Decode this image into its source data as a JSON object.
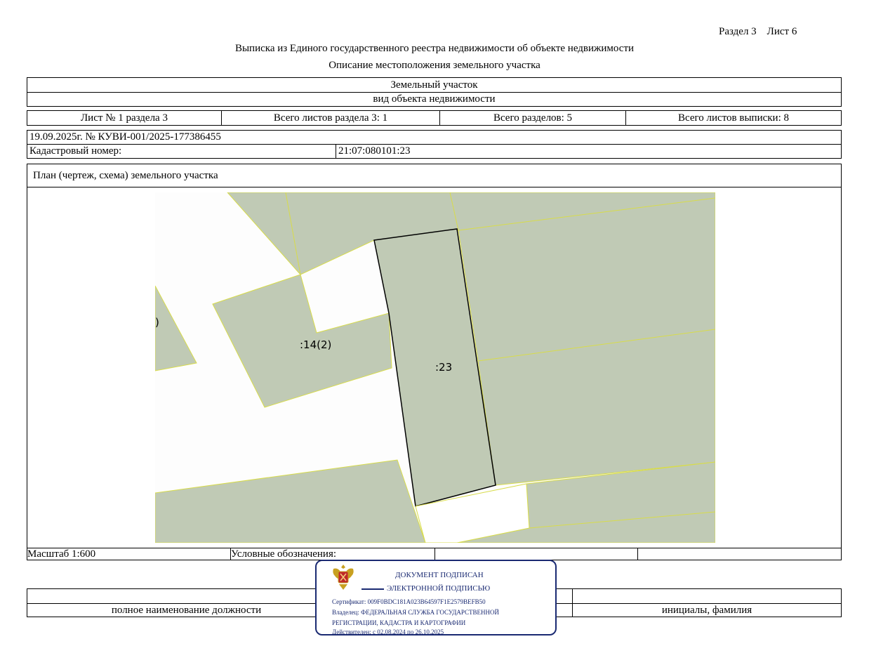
{
  "header": {
    "section_sheet": "Раздел 3    Лист 6",
    "title": "Выписка из Единого государственного реестра недвижимости об объекте недвижимости",
    "subtitle": "Описание местоположения земельного участка"
  },
  "object": {
    "type": "Земельный участок",
    "type_caption": "вид объекта недвижимости"
  },
  "sheets": {
    "sheet_no": "Лист № 1 раздела 3",
    "total_section_sheets": "Всего листов раздела 3: 1",
    "total_sections": "Всего разделов: 5",
    "total_extract_sheets": "Всего листов выписки: 8"
  },
  "record": {
    "date_number": "19.09.2025г. № КУВИ-001/2025-177386455",
    "cadastral_label": "Кадастровый номер:",
    "cadastral_value": "21:07:080101:23"
  },
  "plan": {
    "title": "План (чертеж, схема) земельного участка",
    "labels": {
      "left_cut": ")",
      "parcel_14": ":14(2)",
      "parcel_23": ":23"
    },
    "colors": {
      "parcel_fill": "#c0cab5",
      "parcel_edge": "#d8dc4a",
      "selected_edge": "#000000",
      "background": "#fdfdfd"
    }
  },
  "footer": {
    "scale": "Масштаб 1:600",
    "legend": "Условные обозначения:",
    "position_caption": "полное наименование должности",
    "name_caption": "инициалы, фамилия"
  },
  "stamp": {
    "line1": "ДОКУМЕНТ ПОДПИСАН",
    "line2": "ЭЛЕКТРОННОЙ ПОДПИСЬЮ",
    "certificate": "Сертификат: 009F0BDC181A023B64597F1E2579BEFB50",
    "owner_line1": "Владелец: ФЕДЕРАЛЬНАЯ СЛУЖБА ГОСУДАРСТВЕННОЙ",
    "owner_line2": "РЕГИСТРАЦИИ, КАДАСТРА И КАРТОГРАФИИ",
    "valid": "Действителен: с 02.08.2024 по 26.10.2025",
    "color": "#1a2a72",
    "emblem": "emblem-icon"
  }
}
